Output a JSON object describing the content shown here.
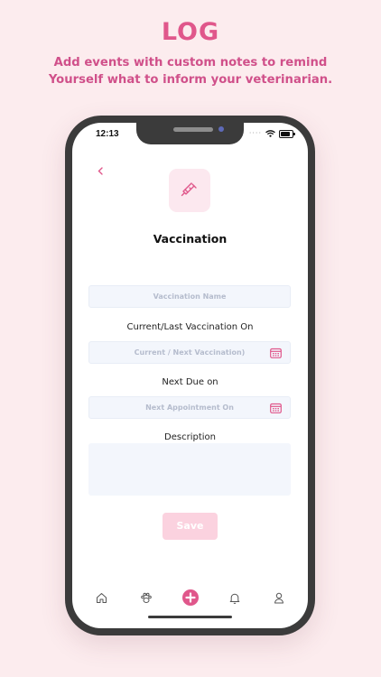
{
  "colors": {
    "background": "#fcecee",
    "accent": "#e0578b",
    "tagline": "#d0508a"
  },
  "headline": "LOG",
  "tagline": {
    "line1": "Add events with custom notes to remind",
    "line2": "Yourself what to inform your veterinarian."
  },
  "status_bar": {
    "time": "12:13"
  },
  "screen": {
    "title": "Vaccination",
    "fields": {
      "vaccination_name": {
        "placeholder": "Vaccination Name"
      },
      "current_label": "Current/Last Vaccination On",
      "current_date": {
        "placeholder": "Current / Next Vaccination)"
      },
      "next_label": "Next Due on",
      "next_date": {
        "placeholder": "Next Appointment On"
      },
      "description_label": "Description"
    },
    "save_label": "Save"
  },
  "bottom_nav": [
    {
      "icon": "home-icon"
    },
    {
      "icon": "paw-icon"
    },
    {
      "icon": "add-icon"
    },
    {
      "icon": "bell-icon"
    },
    {
      "icon": "profile-icon"
    }
  ]
}
